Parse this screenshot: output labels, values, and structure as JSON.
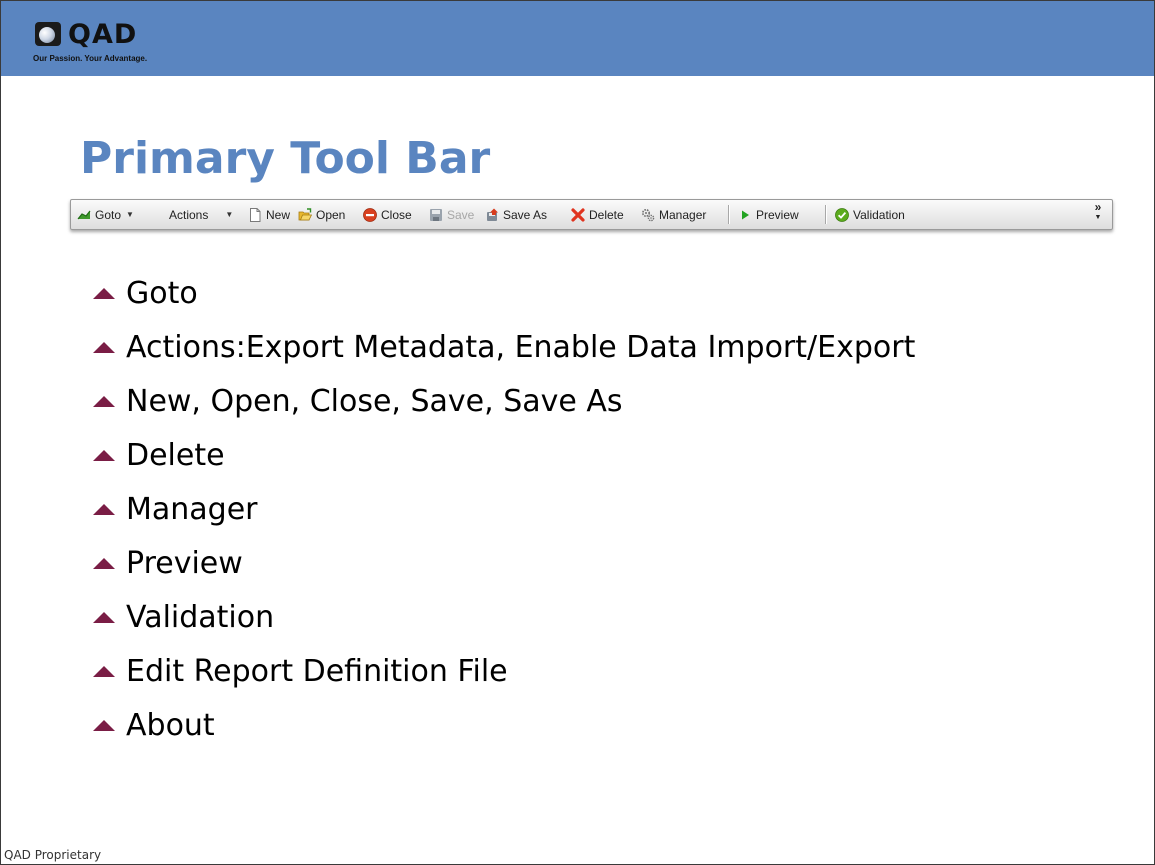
{
  "brand": {
    "name": "QAD",
    "tagline": "Our Passion. Your Advantage."
  },
  "slide": {
    "title": "Primary Tool Bar"
  },
  "toolbar": {
    "goto": "Goto",
    "actions": "Actions",
    "new": "New",
    "open": "Open",
    "close": "Close",
    "save": "Save",
    "save_as": "Save As",
    "delete": "Delete",
    "manager": "Manager",
    "preview": "Preview",
    "validation": "Validation",
    "overflow": "»"
  },
  "bullets": [
    "Goto",
    "Actions:Export Metadata, Enable Data Import/Export",
    "New, Open, Close, Save, Save As",
    "Delete",
    "Manager",
    "Preview",
    "Validation",
    "Edit Report Definition File",
    "About"
  ],
  "footer": {
    "text": "QAD Proprietary"
  },
  "colors": {
    "header": "#5a85c0",
    "title": "#5a85c0",
    "bullet": "#7a1d45",
    "close_icon": "#d9401f",
    "delete_icon": "#e0341f",
    "preview_icon": "#22a321",
    "validation_icon": "#5cab1e"
  }
}
